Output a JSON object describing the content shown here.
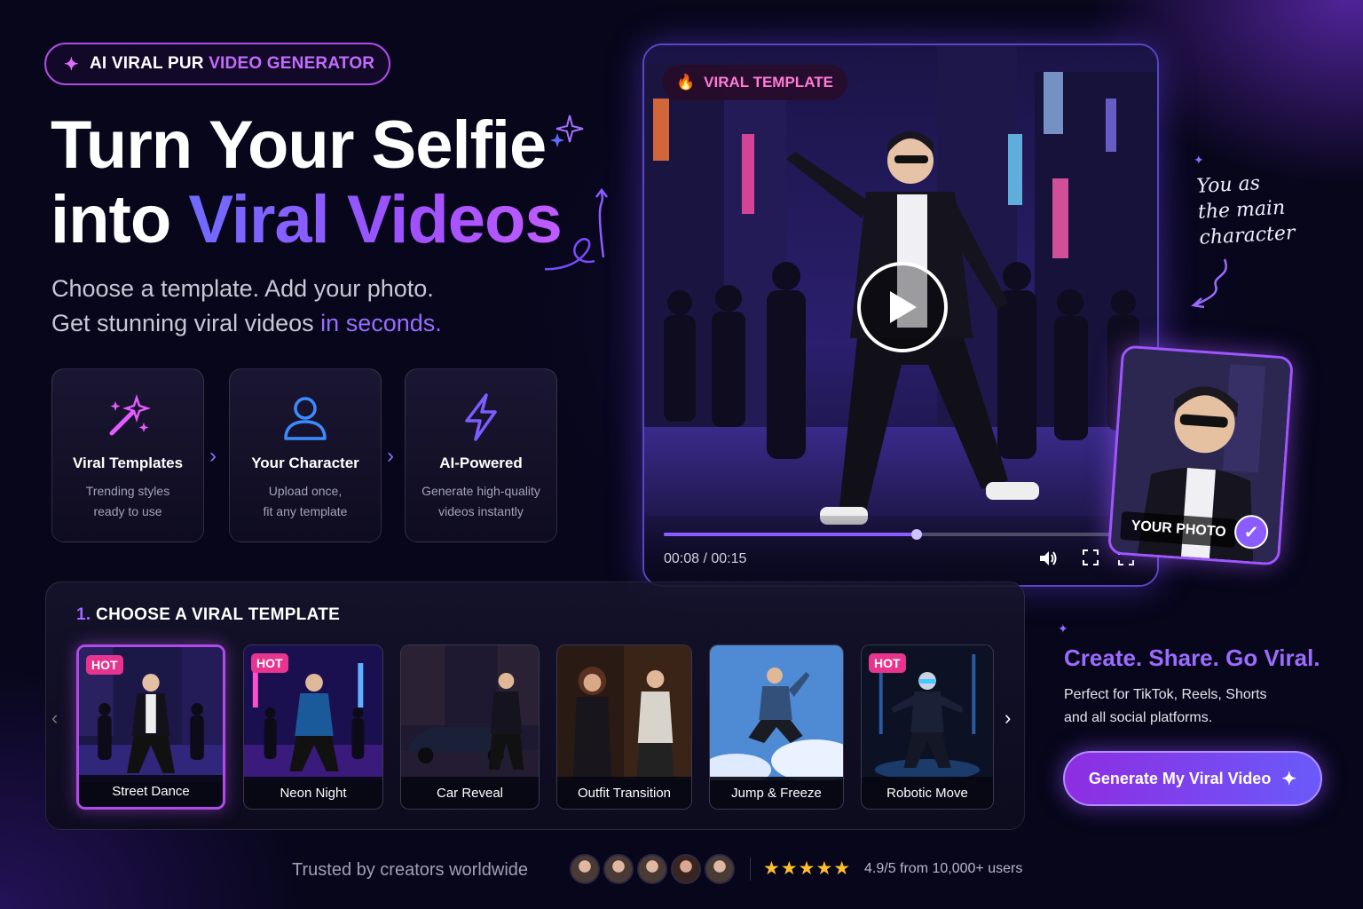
{
  "badge": {
    "prefix": "AI VIRAL PUR ",
    "highlight": "VIDEO GENERATOR",
    "icon": "sparkle-icon"
  },
  "hero": {
    "line1": "Turn Your Selfie",
    "line2_plain": "into ",
    "line2_highlight": "Viral Videos",
    "sub_line1": "Choose a template. Add your photo.",
    "sub_line2_plain": "Get stunning viral videos ",
    "sub_line2_highlight": "in seconds."
  },
  "features": [
    {
      "icon": "magic-wand-icon",
      "title": "Viral Templates",
      "desc1": "Trending styles",
      "desc2": "ready to use"
    },
    {
      "icon": "user-icon",
      "title": "Your Character",
      "desc1": "Upload once,",
      "desc2": "fit any template"
    },
    {
      "icon": "lightning-icon",
      "title": "AI-Powered",
      "desc1": "Generate high-quality",
      "desc2": "videos instantly"
    }
  ],
  "player": {
    "badge": "VIRAL TEMPLATE",
    "badge_icon": "fire-icon",
    "time": "00:08 / 00:15",
    "progress": 0.53
  },
  "photo_card": {
    "label": "YOUR PHOTO"
  },
  "note": {
    "line1": "You as",
    "line2": "the main",
    "line3": "character"
  },
  "templates": {
    "title_num": "1.",
    "title": "CHOOSE A VIRAL TEMPLATE",
    "items": [
      {
        "label": "Street Dance",
        "hot": "HOT"
      },
      {
        "label": "Neon Night",
        "hot": "HOT"
      },
      {
        "label": "Car Reveal",
        "hot": ""
      },
      {
        "label": "Outfit Transition",
        "hot": ""
      },
      {
        "label": "Jump & Freeze",
        "hot": ""
      },
      {
        "label": "Robotic Move",
        "hot": "HOT"
      }
    ]
  },
  "cta": {
    "title": "Create. Share. Go Viral.",
    "sub1": "Perfect for TikTok, Reels, Shorts",
    "sub2": "and all social platforms.",
    "button": "Generate My Viral Video"
  },
  "footer": {
    "trusted": "Trusted by creators worldwide",
    "stars": "★★★★★",
    "rating": "4.9/5 from 10,000+ users"
  },
  "colors": {
    "accent": "#8b5cff",
    "pink": "#e7358f",
    "background": "#07061a"
  }
}
